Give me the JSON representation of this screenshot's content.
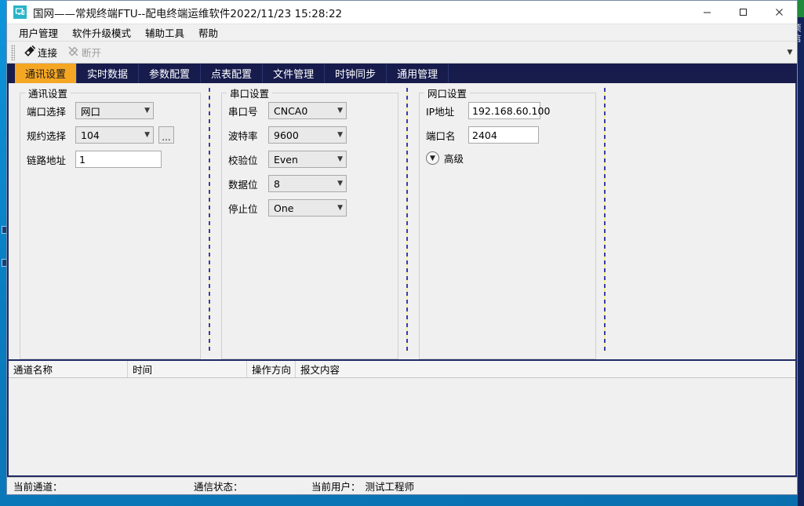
{
  "window": {
    "title": "国网——常规终端FTU--配电终端运维软件2022/11/23 15:28:22",
    "app_icon": "monitor-icon",
    "minimize": "—",
    "maximize": "☐",
    "close": "✕"
  },
  "menubar": {
    "items": [
      {
        "label": "用户管理"
      },
      {
        "label": "软件升级模式"
      },
      {
        "label": "辅助工具"
      },
      {
        "label": "帮助"
      }
    ]
  },
  "toolbar": {
    "connect_label": "连接",
    "disconnect_label": "断开",
    "overflow_icon": "chevron-down-icon"
  },
  "tabs": [
    {
      "label": "通讯设置",
      "active": true
    },
    {
      "label": "实时数据",
      "active": false
    },
    {
      "label": "参数配置",
      "active": false
    },
    {
      "label": "点表配置",
      "active": false
    },
    {
      "label": "文件管理",
      "active": false
    },
    {
      "label": "时钟同步",
      "active": false
    },
    {
      "label": "通用管理",
      "active": false
    }
  ],
  "comm_group": {
    "title": "通讯设置",
    "port_type_label": "端口选择",
    "port_type_value": "网口",
    "protocol_label": "规约选择",
    "protocol_value": "104",
    "protocol_browse": "...",
    "link_addr_label": "链路地址",
    "link_addr_value": "1"
  },
  "serial_group": {
    "title": "串口设置",
    "com_label": "串口号",
    "com_value": "CNCA0",
    "baud_label": "波特率",
    "baud_value": "9600",
    "parity_label": "校验位",
    "parity_value": "Even",
    "databits_label": "数据位",
    "databits_value": "8",
    "stopbits_label": "停止位",
    "stopbits_value": "One"
  },
  "net_group": {
    "title": "网口设置",
    "ip_label": "IP地址",
    "ip_value": "192.168.60.100",
    "port_label": "端口名",
    "port_value": "2404",
    "advanced_label": "高级",
    "advanced_icon": "chevron-down-circle-icon"
  },
  "log_table": {
    "columns": [
      "通道名称",
      "时间",
      "操作方向",
      "报文内容"
    ],
    "rows": []
  },
  "statusbar": {
    "channel_label": "当前通道：",
    "comm_state_label": "通信状态：",
    "user_label": "当前用户：",
    "user_value": "测试工程师"
  },
  "desktop": {
    "right_edge_text": "项信"
  },
  "colors": {
    "nav_bg": "#171c4d",
    "tab_active": "#f5a623",
    "panel_border": "#1f2a66",
    "window_bg": "#f0f0f0",
    "desktop_blue": "#0b8fd4"
  }
}
